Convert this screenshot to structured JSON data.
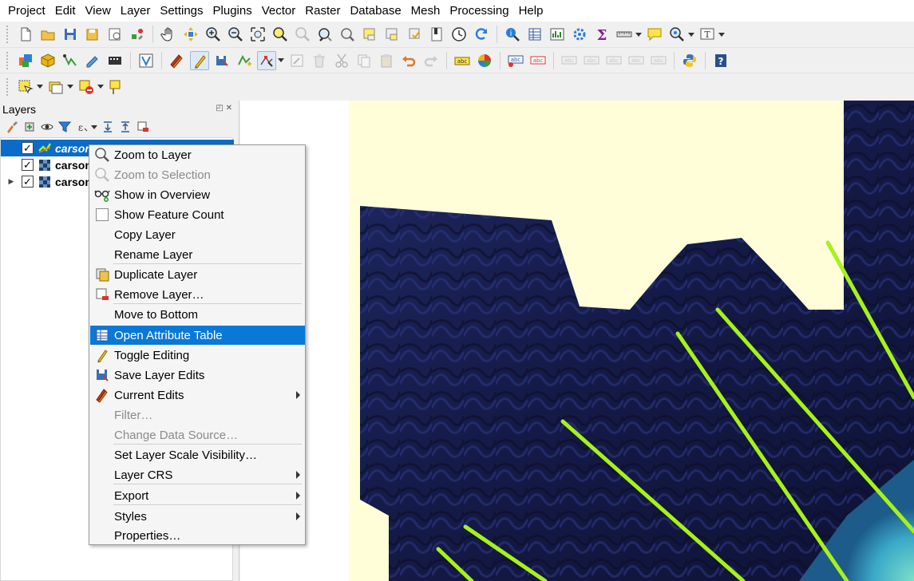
{
  "menubar": {
    "items": [
      "Project",
      "Edit",
      "View",
      "Layer",
      "Settings",
      "Plugins",
      "Vector",
      "Raster",
      "Database",
      "Mesh",
      "Processing",
      "Help"
    ]
  },
  "layers_panel": {
    "title": "Layers",
    "layers": [
      {
        "name": "carson",
        "checked": true,
        "selected": true,
        "type": "vector-line"
      },
      {
        "name": "carson",
        "checked": true,
        "selected": false,
        "type": "raster"
      },
      {
        "name": "carson",
        "checked": true,
        "selected": false,
        "type": "raster",
        "expandable": true
      }
    ]
  },
  "context_menu": {
    "items": [
      {
        "label": "Zoom to Layer",
        "icon": "zoom-layer-icon"
      },
      {
        "label": "Zoom to Selection",
        "icon": "zoom-selection-icon",
        "disabled": true
      },
      {
        "label": "Show in Overview",
        "icon": "overview-icon"
      },
      {
        "label": "Show Feature Count",
        "icon": "checkbox-icon"
      },
      {
        "label": "Copy Layer"
      },
      {
        "label": "Rename Layer"
      },
      {
        "label": "Duplicate Layer",
        "icon": "duplicate-icon"
      },
      {
        "label": "Remove Layer…",
        "icon": "remove-icon"
      },
      {
        "label": "Move to Bottom"
      },
      {
        "label": "Open Attribute Table",
        "icon": "table-icon",
        "highlighted": true
      },
      {
        "label": "Toggle Editing",
        "icon": "pencil-icon"
      },
      {
        "label": "Save Layer Edits",
        "icon": "save-edits-icon"
      },
      {
        "label": "Current Edits",
        "icon": "current-edits-icon",
        "submenu": true
      },
      {
        "label": "Filter…",
        "disabled": true
      },
      {
        "label": "Change Data Source…",
        "disabled": true
      },
      {
        "label": "Set Layer Scale Visibility…"
      },
      {
        "label": "Layer CRS",
        "submenu": true
      },
      {
        "label": "Export",
        "submenu": true
      },
      {
        "label": "Styles",
        "submenu": true
      },
      {
        "label": "Properties…"
      }
    ]
  },
  "colors": {
    "selection_blue": "#0a6cc8",
    "menu_highlight": "#0a78d7",
    "map_background_fill": "#fffed9",
    "relief_dark": "#151a45",
    "line_green": "#a6f21a",
    "water_cyan": "#55c8d0"
  }
}
